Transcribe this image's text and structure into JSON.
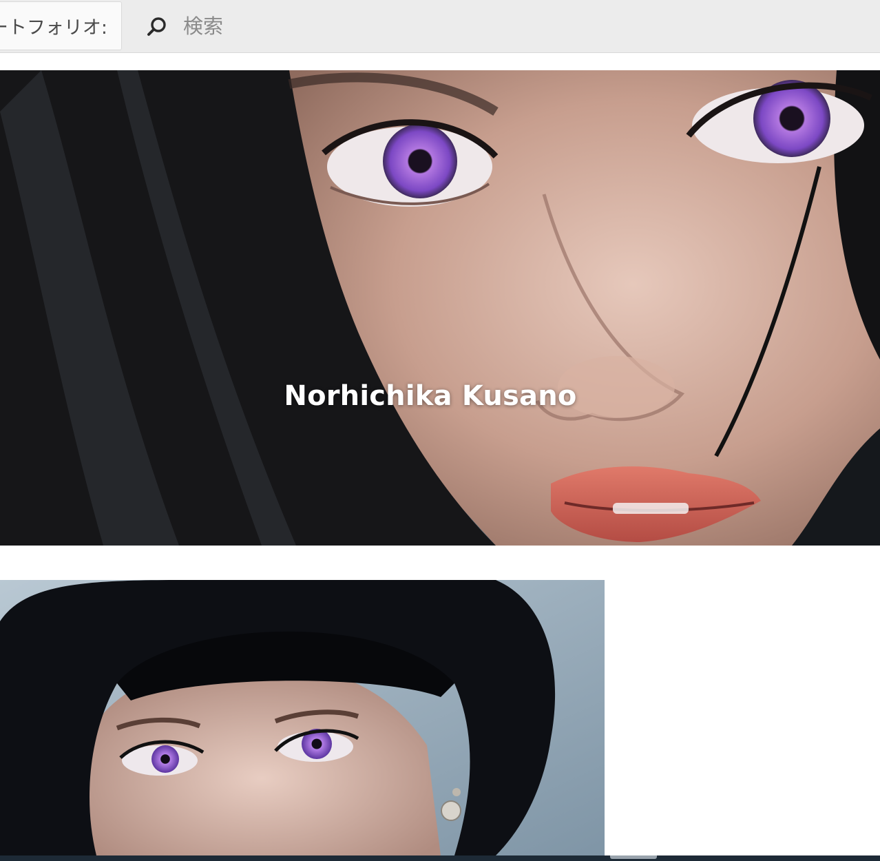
{
  "toolbar": {
    "scope_label": "ートフォリオ:",
    "search_placeholder": "検索",
    "search_value": ""
  },
  "hero": {
    "title": "Norhichika Kusano"
  },
  "icons": {
    "search": "magnifier-icon"
  },
  "colors": {
    "toolbar_bg": "#ececec",
    "hero_text": "#ffffff",
    "iris": "#8c58d6"
  }
}
